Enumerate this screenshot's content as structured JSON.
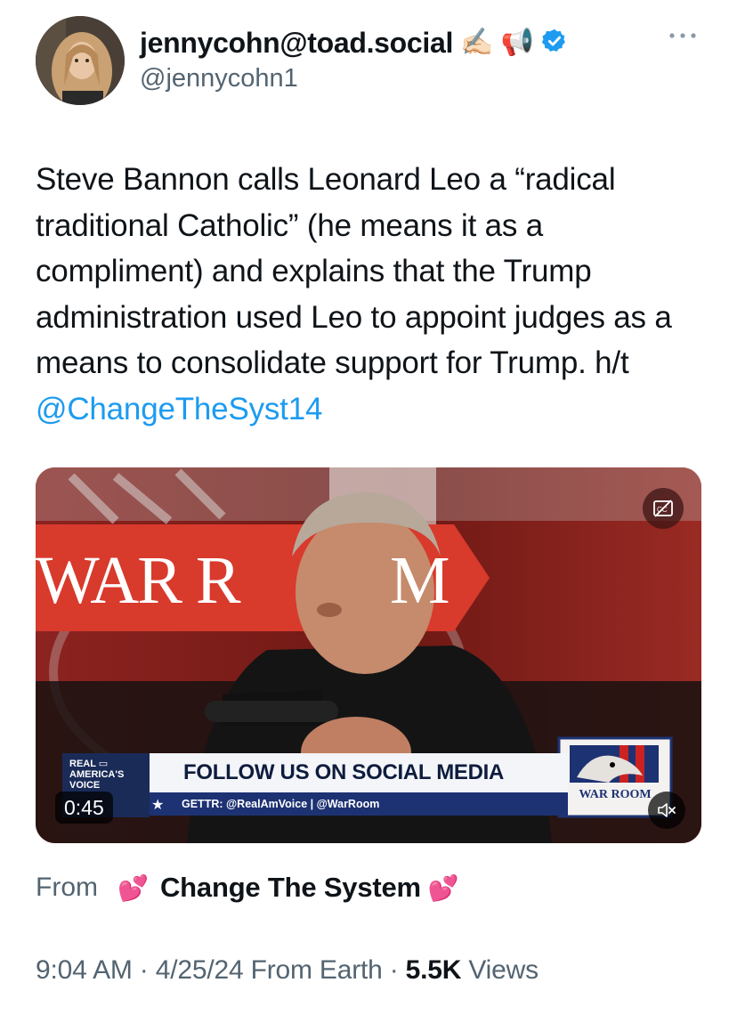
{
  "author": {
    "display_name": "jennycohn@toad.social",
    "handle": "@jennycohn1",
    "badges": [
      "writing-hand-emoji",
      "megaphone-emoji",
      "verified-badge-icon"
    ],
    "verified_color": "#1d9bf0"
  },
  "tweet": {
    "text_plain": "Steve Bannon calls Leonard Leo a “radical traditional Catholic” (he means it as a compliment) and explains that the Trump administration used Leo to appoint judges as a means to consolidate support for Trump. h/t ",
    "mention": "@ChangeTheSyst14",
    "mention_color": "#1d9bf0"
  },
  "video": {
    "duration": "0:45",
    "backdrop_text_left": "WAR R",
    "backdrop_text_right": "M",
    "lower_third": {
      "brand": "REAL\nAMERICA'S\nVOICE",
      "headline": "FOLLOW US ON SOCIAL MEDIA",
      "subline": "GETTR: @RealAmVoice | @WarRoom"
    },
    "corner_logo_text": "WAR ROOM",
    "icons": [
      "captions-off-icon",
      "speaker-muted-icon"
    ]
  },
  "source": {
    "from_label": "From",
    "app_name": "Change The System",
    "emoji": "💕"
  },
  "meta": {
    "time": "9:04 AM",
    "date": "4/25/24",
    "location": "From Earth",
    "views_count": "5.5K",
    "views_label": "Views"
  }
}
